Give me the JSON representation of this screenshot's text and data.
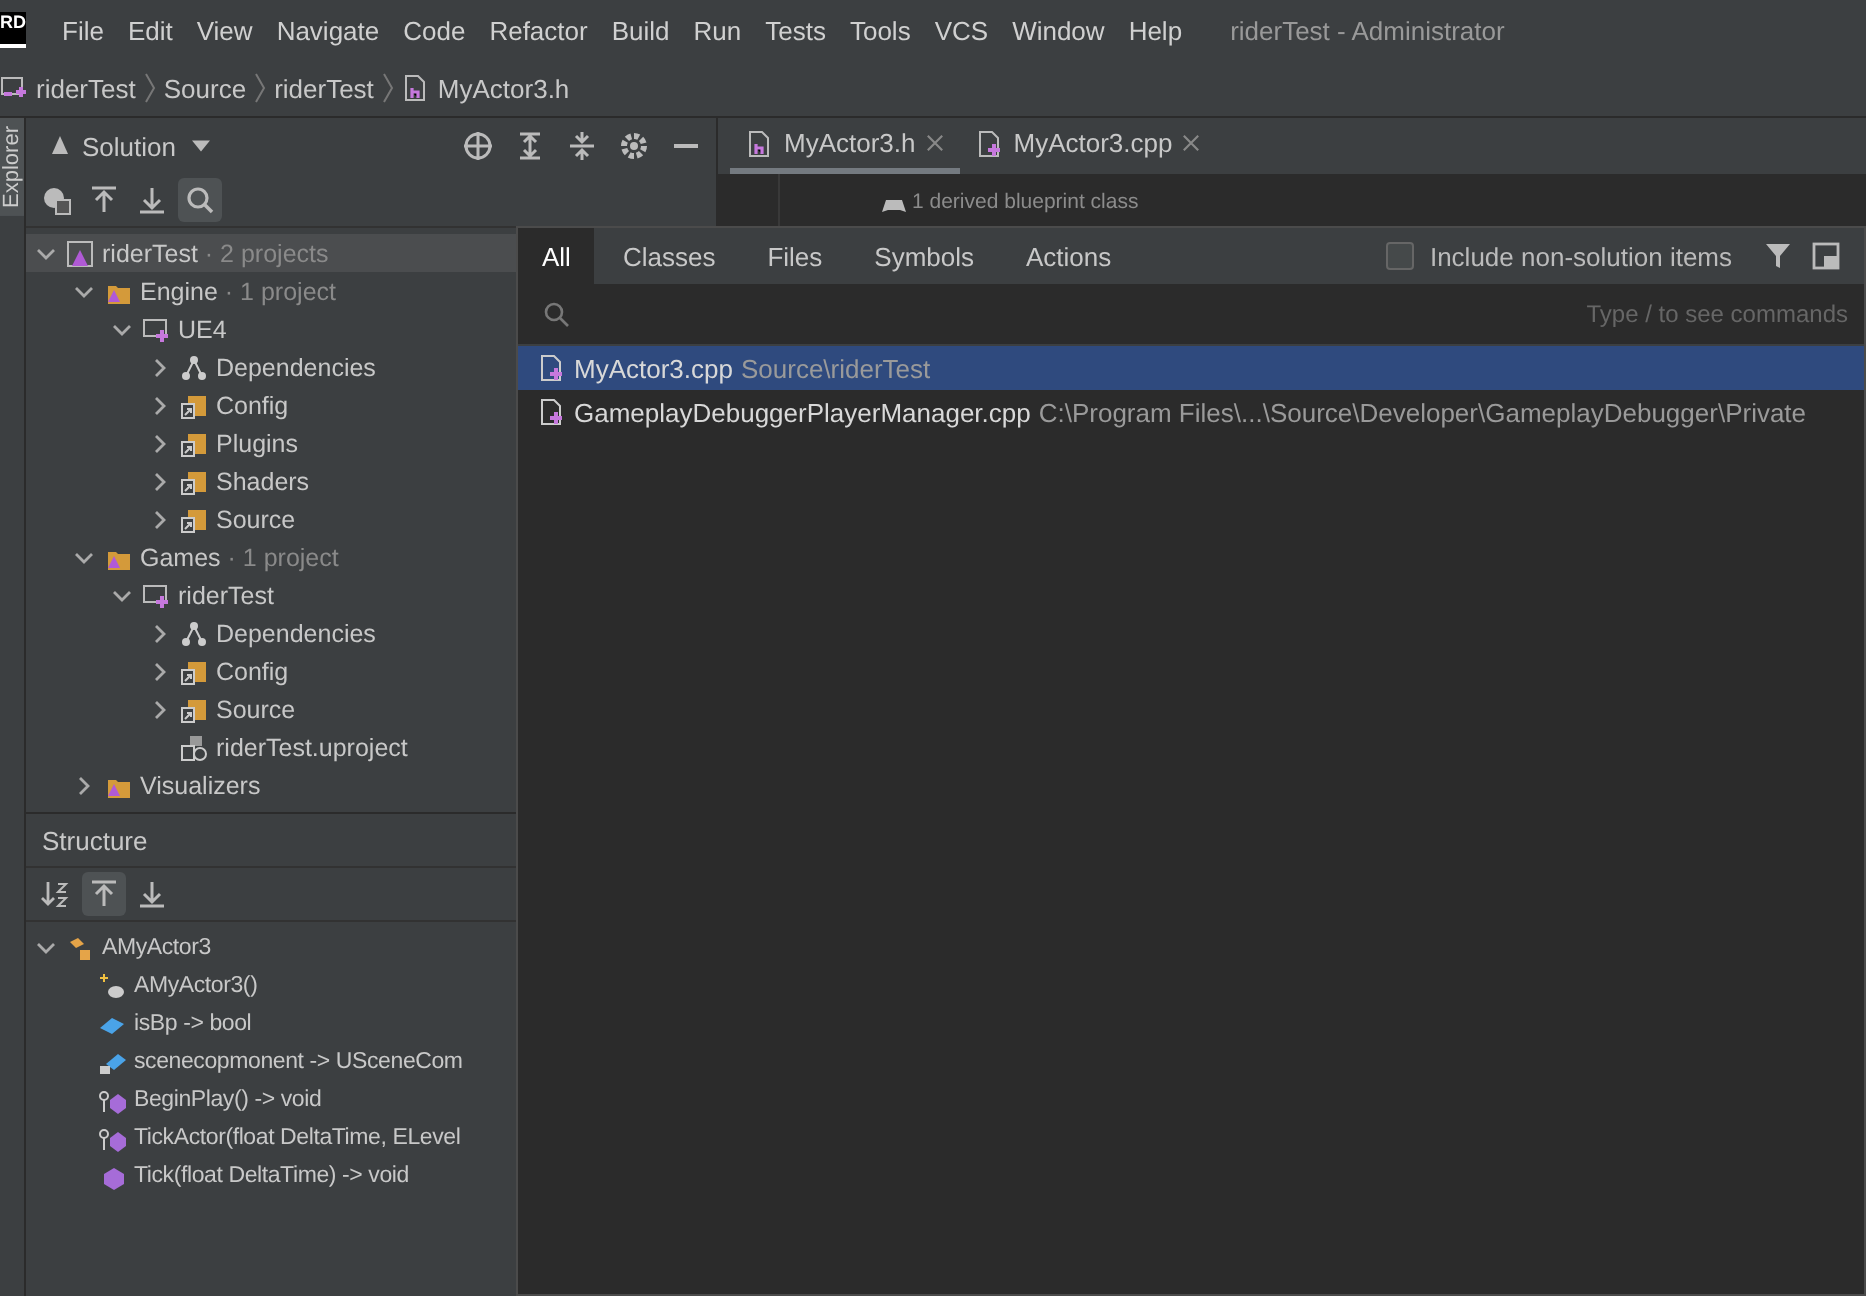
{
  "app_logo": "RD",
  "menu": [
    "File",
    "Edit",
    "View",
    "Navigate",
    "Code",
    "Refactor",
    "Build",
    "Run",
    "Tests",
    "Tools",
    "VCS",
    "Window",
    "Help"
  ],
  "window": {
    "title": "riderTest - Administrator"
  },
  "breadcrumb": [
    "riderTest",
    "Source",
    "riderTest",
    "MyActor3.h"
  ],
  "side_strip": {
    "label": "Explorer"
  },
  "solution": {
    "title": "Solution",
    "tree": [
      {
        "label": "riderTest",
        "suffix": " · 2 projects",
        "kind": "solution",
        "expanded": true,
        "selected": true,
        "children": [
          {
            "label": "Engine",
            "suffix": " · 1 project",
            "kind": "group",
            "expanded": true,
            "selected": false,
            "children": [
              {
                "label": "UE4",
                "kind": "project",
                "expanded": true,
                "selected": false,
                "children": [
                  {
                    "label": "Dependencies",
                    "kind": "deps",
                    "expanded": false,
                    "selected": false
                  },
                  {
                    "label": "Config",
                    "kind": "folder",
                    "expanded": false,
                    "selected": false
                  },
                  {
                    "label": "Plugins",
                    "kind": "folder",
                    "expanded": false,
                    "selected": false
                  },
                  {
                    "label": "Shaders",
                    "kind": "folder",
                    "expanded": false,
                    "selected": false
                  },
                  {
                    "label": "Source",
                    "kind": "folder",
                    "expanded": false,
                    "selected": false
                  }
                ]
              }
            ]
          },
          {
            "label": "Games",
            "suffix": " · 1 project",
            "kind": "group",
            "expanded": true,
            "selected": false,
            "children": [
              {
                "label": "riderTest",
                "kind": "project",
                "expanded": true,
                "selected": false,
                "children": [
                  {
                    "label": "Dependencies",
                    "kind": "deps",
                    "expanded": false,
                    "selected": false
                  },
                  {
                    "label": "Config",
                    "kind": "folder",
                    "expanded": false,
                    "selected": false
                  },
                  {
                    "label": "Source",
                    "kind": "folder",
                    "expanded": false,
                    "selected": false
                  },
                  {
                    "label": "riderTest.uproject",
                    "kind": "file",
                    "selected": false
                  }
                ]
              }
            ]
          },
          {
            "label": "Visualizers",
            "kind": "group",
            "expanded": false,
            "selected": false
          }
        ]
      }
    ]
  },
  "structure": {
    "title": "Structure",
    "tree": [
      {
        "label": "AMyActor3",
        "kind": "class",
        "expanded": true,
        "children": [
          {
            "label": "AMyActor3()",
            "kind": "ctor"
          },
          {
            "label": "isBp -> bool",
            "kind": "field"
          },
          {
            "label": "scenecopmonent -> USceneCom",
            "kind": "field-private"
          },
          {
            "label": "BeginPlay() -> void",
            "kind": "virtual"
          },
          {
            "label": "TickActor(float DeltaTime, ELevel",
            "kind": "virtual"
          },
          {
            "label": "Tick(float DeltaTime) -> void",
            "kind": "method"
          }
        ]
      }
    ]
  },
  "editor": {
    "tabs": [
      {
        "label": "MyActor3.h",
        "kind": "header",
        "selected": true
      },
      {
        "label": "MyActor3.cpp",
        "kind": "source",
        "selected": false
      }
    ],
    "hint": "1 derived blueprint class"
  },
  "search_popup": {
    "tabs": [
      {
        "label": "All",
        "selected": true
      },
      {
        "label": "Classes",
        "selected": false
      },
      {
        "label": "Files",
        "selected": false
      },
      {
        "label": "Symbols",
        "selected": false
      },
      {
        "label": "Actions",
        "selected": false
      }
    ],
    "include_non_solution": {
      "label": "Include non-solution items",
      "checked": false
    },
    "hint": "Type / to see commands",
    "results": [
      {
        "name": "MyActor3.cpp",
        "path": "Source\\riderTest",
        "selected": true
      },
      {
        "name": "GameplayDebuggerPlayerManager.cpp",
        "path": "C:\\Program Files\\...\\Source\\Developer\\GameplayDebugger\\Private",
        "selected": false
      }
    ]
  }
}
